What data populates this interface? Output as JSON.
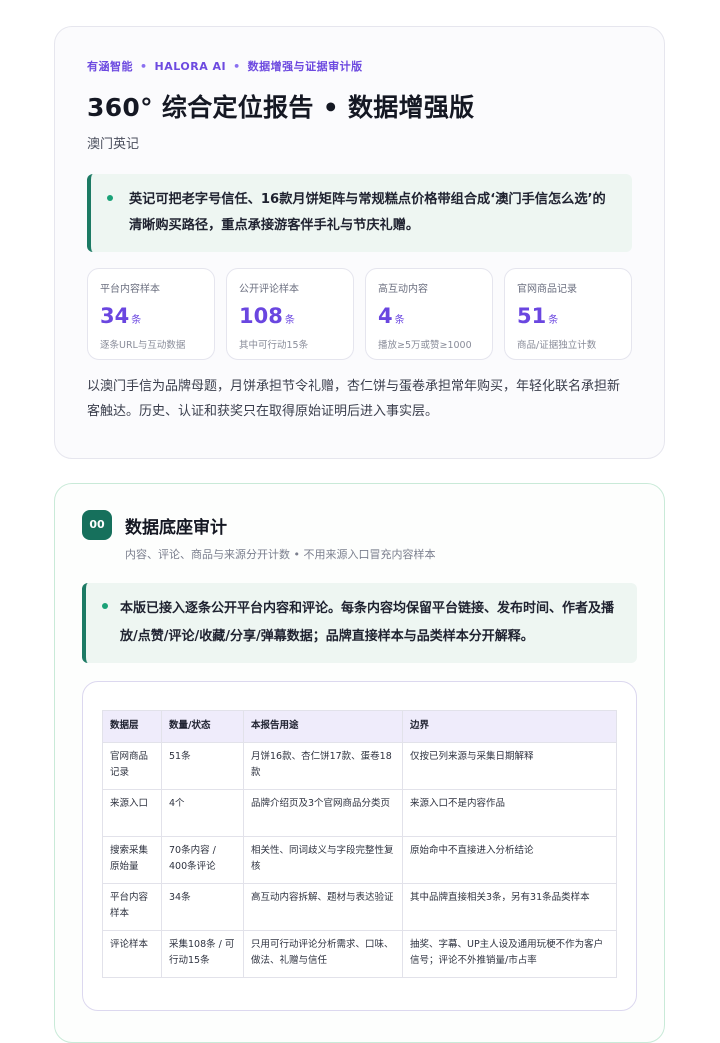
{
  "header": {
    "eyebrow": [
      "有涵智能",
      "HALORA AI",
      "数据增强与证据审计版"
    ],
    "eyebrow_separator": "•",
    "title": "360° 综合定位报告 • 数据增强版",
    "subtitle": "澳门英记"
  },
  "summary": "英记可把老字号信任、16款月饼矩阵与常规糕点价格带组合成‘澳门手信怎么选’的清晰购买路径，重点承接游客伴手礼与节庆礼赠。",
  "stats": [
    {
      "label": "平台内容样本",
      "value": "34",
      "unit": "条",
      "note": "逐条URL与互动数据"
    },
    {
      "label": "公开评论样本",
      "value": "108",
      "unit": "条",
      "note": "其中可行动15条"
    },
    {
      "label": "高互动内容",
      "value": "4",
      "unit": "条",
      "note": "播放≥5万或赞≥1000"
    },
    {
      "label": "官网商品记录",
      "value": "51",
      "unit": "条",
      "note": "商品/证据独立计数"
    }
  ],
  "intro_paragraph": "以澳门手信为品牌母题，月饼承担节令礼赠，杏仁饼与蛋卷承担常年购买，年轻化联名承担新客触达。历史、认证和获奖只在取得原始证明后进入事实层。",
  "section": {
    "number": "00",
    "title": "数据底座审计",
    "subtitle": "内容、评论、商品与来源分开计数 • 不用来源入口冒充内容样本",
    "highlight": "本版已接入逐条公开平台内容和评论。每条内容均保留平台链接、发布时间、作者及播放/点赞/评论/收藏/分享/弹幕数据；品牌直接样本与品类样本分开解释。"
  },
  "table": {
    "headers": [
      "数据层",
      "数量/状态",
      "本报告用途",
      "边界"
    ],
    "rows": [
      [
        "官网商品记录",
        "51条",
        "月饼16款、杏仁饼17款、蛋卷18款",
        "仅按已列来源与采集日期解释"
      ],
      [
        "来源入口",
        "4个",
        "品牌介绍页及3个官网商品分类页",
        "来源入口不是内容作品"
      ],
      [
        "搜索采集原始量",
        "70条内容 / 400条评论",
        "相关性、同词歧义与字段完整性复核",
        "原始命中不直接进入分析结论"
      ],
      [
        "平台内容样本",
        "34条",
        "高互动内容拆解、题材与表达验证",
        "其中品牌直接相关3条，另有31条品类样本"
      ],
      [
        "评论样本",
        "采集108条 / 可行动15条",
        "只用可行动评论分析需求、口味、做法、礼赠与信任",
        "抽奖、字幕、UP主人设及通用玩梗不作为客户信号；评论不外推销量/市占率"
      ]
    ]
  }
}
